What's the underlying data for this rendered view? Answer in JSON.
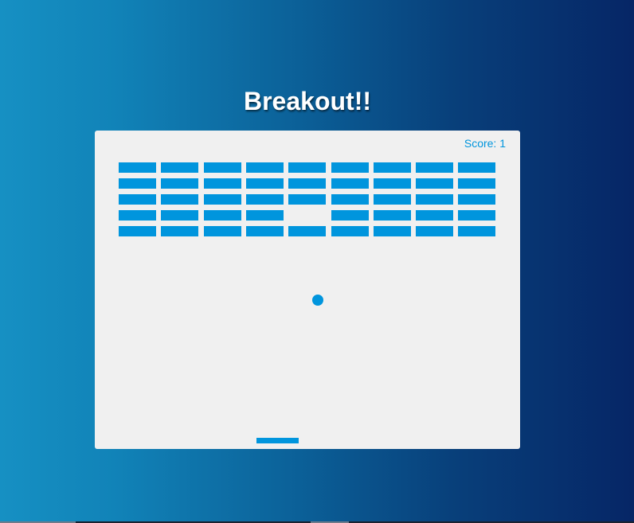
{
  "game": {
    "title": "Breakout!!",
    "score_label": "Score: 1"
  },
  "bricks": {
    "columns": 9,
    "rows": 5,
    "broken": [
      [
        4,
        3
      ]
    ]
  },
  "colors": {
    "accent": "#0095dd",
    "board": "#f0f0f0",
    "title": "#ffffff"
  }
}
